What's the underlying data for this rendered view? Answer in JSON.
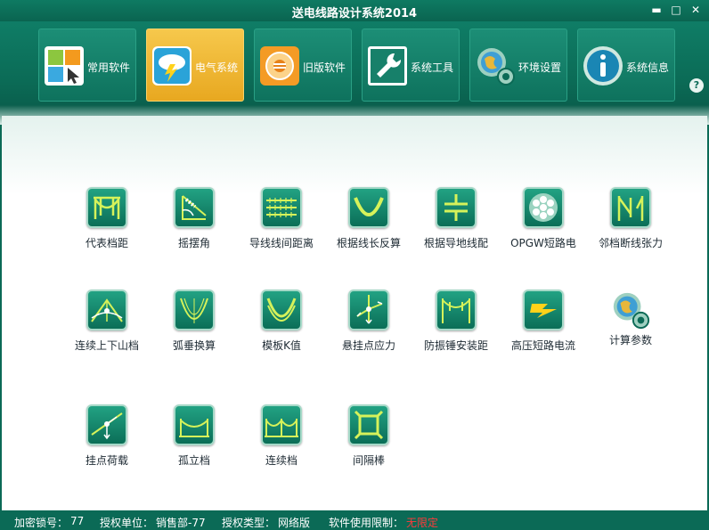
{
  "window": {
    "title": "送电线路设计系统2014",
    "minimize_glyph": "▬",
    "maximize_glyph": "□",
    "close_glyph": "✕"
  },
  "toolbar": {
    "buttons": [
      {
        "label": "常用软件",
        "icon": "apps-grid-icon"
      },
      {
        "label": "电气系统",
        "icon": "cloud-lightning-icon",
        "active": true
      },
      {
        "label": "旧版软件",
        "icon": "legacy-disc-icon"
      },
      {
        "label": "系统工具",
        "icon": "wrench-icon"
      },
      {
        "label": "环境设置",
        "icon": "globe-gear-icon"
      },
      {
        "label": "系统信息",
        "icon": "info-icon"
      }
    ],
    "help_glyph": "?"
  },
  "tools": [
    {
      "label": "代表档距",
      "icon": "span-arch-icon"
    },
    {
      "label": "摇摆角",
      "icon": "swing-angle-icon"
    },
    {
      "label": "导线线间距离",
      "icon": "conductor-spacing-icon"
    },
    {
      "label": "根据线长反算",
      "icon": "sag-curve-icon"
    },
    {
      "label": "根据导地线配",
      "icon": "conductor-match-icon"
    },
    {
      "label": "OPGW短路电",
      "icon": "opgw-cable-icon"
    },
    {
      "label": "邻档断线张力",
      "icon": "broken-wire-icon"
    },
    {
      "label": "连续上下山档",
      "icon": "mountain-span-icon"
    },
    {
      "label": "弧垂换算",
      "icon": "sag-convert-icon"
    },
    {
      "label": "模板K值",
      "icon": "template-k-icon"
    },
    {
      "label": "悬挂点应力",
      "icon": "suspension-stress-icon"
    },
    {
      "label": "防振锤安装距",
      "icon": "damper-distance-icon"
    },
    {
      "label": "高压短路电流",
      "icon": "lightning-current-icon"
    },
    {
      "label": "计算参数",
      "icon": "globe-gear-icon"
    },
    {
      "label": "挂点荷载",
      "icon": "point-load-icon"
    },
    {
      "label": "孤立档",
      "icon": "isolated-span-icon"
    },
    {
      "label": "连续档",
      "icon": "continuous-span-icon"
    },
    {
      "label": "间隔棒",
      "icon": "spacer-icon"
    }
  ],
  "status": {
    "lock_label": "加密锁号：",
    "lock_value": "77",
    "unit_label": "授权单位：",
    "unit_value": "销售部-77",
    "type_label": "授权类型：",
    "type_value": "网络版",
    "limit_label": "软件使用限制：",
    "limit_value": "无限定"
  },
  "colors": {
    "frame": "#0b6a56",
    "active_tab": "#f0b832",
    "tile_icon": "#11846a",
    "limit_text": "#ff3a3a"
  }
}
